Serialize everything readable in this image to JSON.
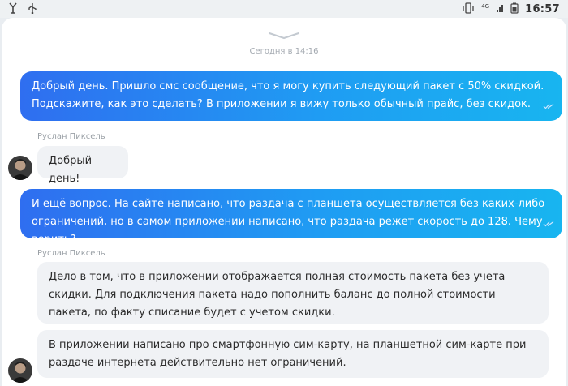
{
  "status_bar": {
    "time": "16:57",
    "network": "4G",
    "icons": [
      "notification-icon",
      "usb-icon",
      "vibrate-icon",
      "signal-icon",
      "battery-icon"
    ]
  },
  "chat": {
    "date_separator": "Сегодня в 14:16",
    "messages": [
      {
        "direction": "outgoing",
        "text": "Добрый день. Пришло смс сообщение, что я могу купить следующий пакет с 50% скидкой. Подскажите, как это сделать? В приложении я вижу только обычный прайс, без скидок.",
        "read": true
      },
      {
        "direction": "incoming",
        "sender": "Руслан Пиксель",
        "text": "Добрый день!"
      },
      {
        "direction": "outgoing",
        "text": "И ещё вопрос. На сайте написано, что раздача с планшета осуществляется без каких-либо ограничений, но в самом приложении написано, что раздача режет скорость до 128. Чему верить?",
        "read": true
      },
      {
        "direction": "incoming",
        "sender": "Руслан Пиксель",
        "text": "Дело в том, что в приложении отображается полная стоимость пакета без учета скидки. Для подключения пакета надо пополнить баланс до полной стоимости пакета, по факту списание будет с учетом скидки."
      },
      {
        "direction": "incoming",
        "text": "В приложении написано про смартфонную сим-карту, на планшетной сим-карте при раздаче интернета действительно нет ограничений."
      }
    ]
  },
  "colors": {
    "bubble_out_start": "#2f6ef0",
    "bubble_out_end": "#18b5f0",
    "bubble_in": "#f0f2f5",
    "background": "#ffffff"
  }
}
